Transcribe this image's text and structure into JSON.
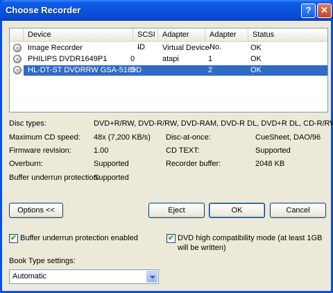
{
  "window": {
    "title": "Choose Recorder",
    "help_label": "?",
    "close_label": "✕"
  },
  "recorders": {
    "columns": [
      "Device",
      "SCSI ID",
      "Adapter",
      "Adapter No.",
      "Status"
    ],
    "rows": [
      {
        "device": "Image Recorder",
        "scsi_id": "-",
        "adapter": "Virtual Device",
        "adapter_no": "-",
        "status": "OK",
        "selected": false
      },
      {
        "device": "PHILIPS  DVDR1649P1",
        "scsi_id": "0",
        "adapter": "atapi",
        "adapter_no": "1",
        "status": "OK",
        "selected": false
      },
      {
        "device": "HL-DT-ST DVDRRW GSA-5169D",
        "scsi_id": "0",
        "adapter": "",
        "adapter_no": "2",
        "status": "OK",
        "selected": true
      }
    ]
  },
  "info": {
    "disc_types_label": "Disc types:",
    "disc_types_value": "DVD+R/RW, DVD-R/RW, DVD-RAM, DVD-R DL, DVD+R DL, CD-R/RW",
    "max_cd_speed_label": "Maximum CD speed:",
    "max_cd_speed_value": "48x (7,200 KB/s)",
    "disc_at_once_label": "Disc-at-once:",
    "disc_at_once_value": "CueSheet, DAO/96",
    "firmware_label": "Firmware revision:",
    "firmware_value": "1.00",
    "cd_text_label": "CD TEXT:",
    "cd_text_value": "Supported",
    "overburn_label": "Overburn:",
    "overburn_value": "Supported",
    "buffer_label": "Recorder buffer:",
    "buffer_value": "2048 KB",
    "underrun_label": "Buffer underrun protection:",
    "underrun_value": "Supported"
  },
  "buttons": {
    "options": "Options <<",
    "eject": "Eject",
    "ok": "OK",
    "cancel": "Cancel"
  },
  "options": {
    "underrun_checkbox": "Buffer underrun protection enabled",
    "dvd_compat_checkbox": "DVD high compatibility mode (at least 1GB will be written)",
    "book_type_label": "Book Type settings:",
    "book_type_value": "Automatic"
  }
}
